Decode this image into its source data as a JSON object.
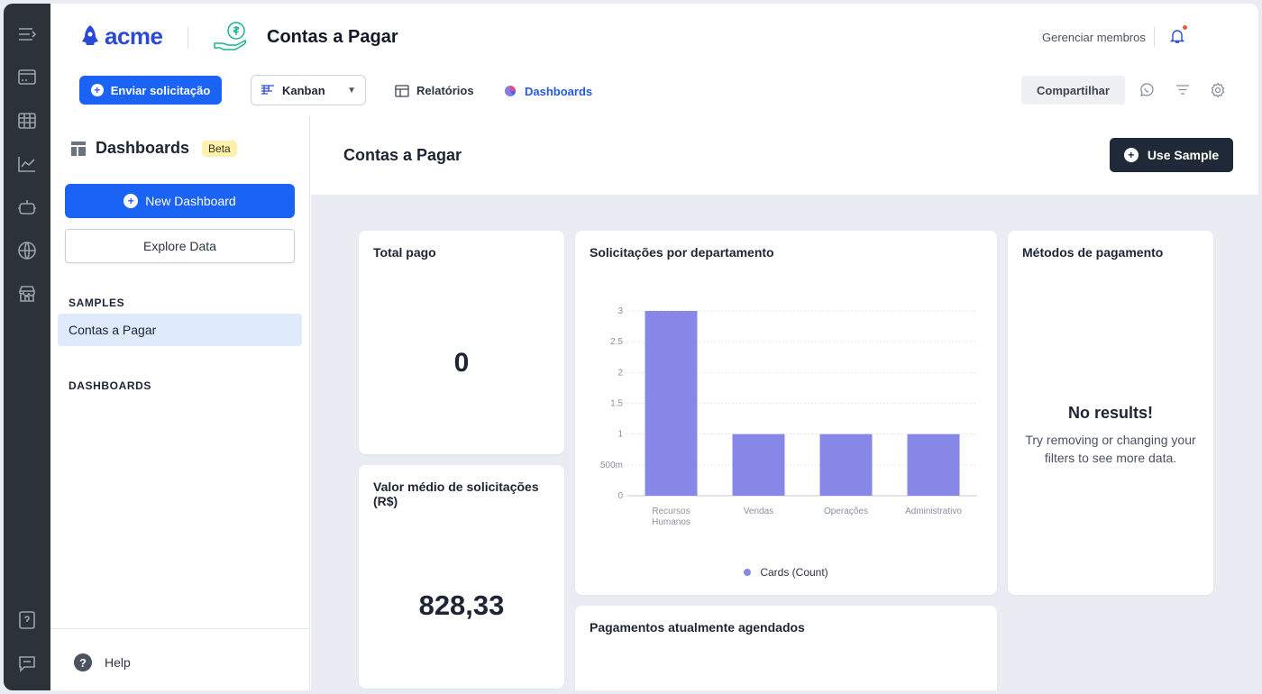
{
  "header": {
    "logo_text": "acme",
    "title": "Contas a Pagar",
    "manage_members": "Gerenciar membros",
    "send_request": "Enviar solicitação",
    "view_select": "Kanban",
    "reports": "Relatórios",
    "dashboards": "Dashboards",
    "share": "Compartilhar"
  },
  "sidebar": {
    "title": "Dashboards",
    "badge": "Beta",
    "new_dashboard": "New Dashboard",
    "explore_data": "Explore Data",
    "samples_heading": "SAMPLES",
    "sample_item": "Contas a Pagar",
    "dashboards_heading": "DASHBOARDS",
    "help": "Help"
  },
  "main": {
    "title": "Contas a Pagar",
    "use_sample": "Use Sample",
    "cards": {
      "total_paid": {
        "title": "Total pago",
        "value": "0"
      },
      "avg_value": {
        "title": "Valor médio de solicitações (R$)",
        "value": "828,33"
      },
      "by_department": {
        "title": "Solicitações por departamento"
      },
      "payment_methods": {
        "title": "Métodos de pagamento",
        "empty_title": "No results!",
        "empty_text": "Try removing or changing your filters to see more data."
      },
      "scheduled": {
        "title": "Pagamentos atualmente agendados"
      }
    }
  },
  "chart_data": {
    "type": "bar",
    "title": "Solicitações por departamento",
    "categories": [
      "Recursos Humanos",
      "Vendas",
      "Operações",
      "Administrativo"
    ],
    "category_lines": [
      [
        "Recursos",
        "Humanos"
      ],
      [
        "Vendas"
      ],
      [
        "Operações"
      ],
      [
        "Administrativo"
      ]
    ],
    "series": [
      {
        "name": "Cards (Count)",
        "values": [
          3,
          1,
          1,
          1
        ]
      }
    ],
    "yticks": [
      0,
      0.5,
      1,
      1.5,
      2,
      2.5,
      3
    ],
    "ytick_labels": [
      "0",
      "500m",
      "1",
      "1.5",
      "2",
      "2.5",
      "3"
    ],
    "ylim": [
      0,
      3
    ],
    "grid": true,
    "legend_position": "bottom",
    "color": "#8787e8"
  }
}
